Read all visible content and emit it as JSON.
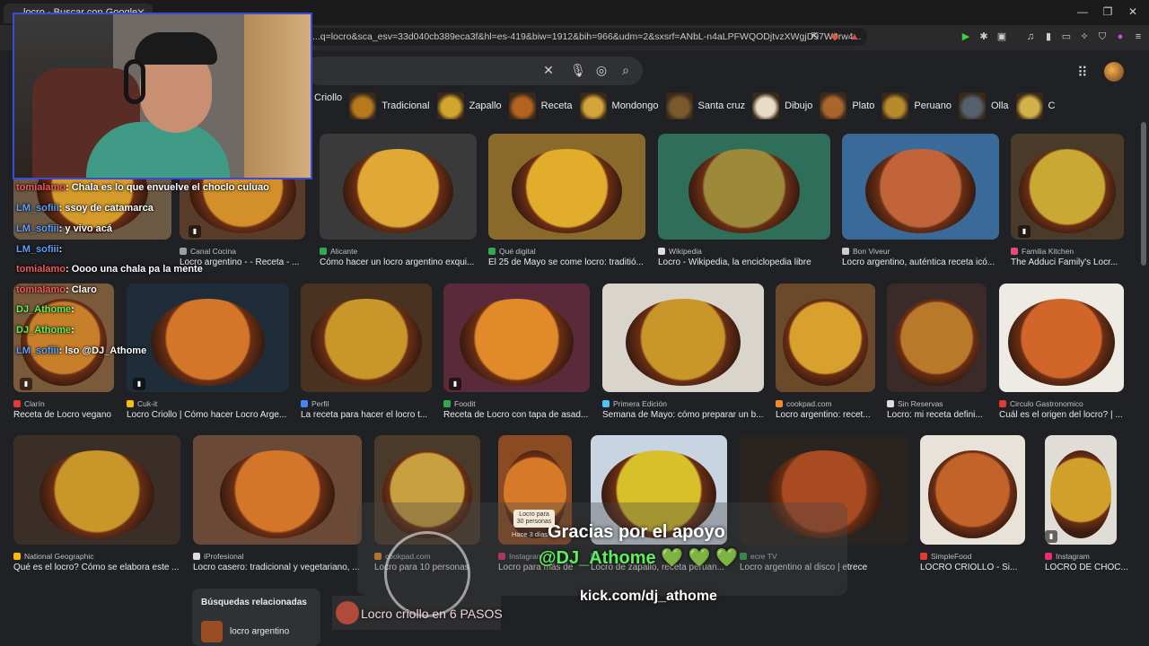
{
  "browser": {
    "tab_title": "locro - Buscar con Google",
    "url": "...q=locro&sca_esv=33d040cb389eca3f&hl=es-419&biw=1912&bih=966&udm=2&sxsrf=ANbL-n4aLPFWQODjtvzXWgjD97W9rw4...",
    "controls": {
      "minimize": "—",
      "restore": "❐",
      "close": "✕"
    }
  },
  "search": {
    "clear_icon": "✕"
  },
  "chips": [
    {
      "label": "Criollo",
      "color": "#c98a2a",
      "has_thumb": false
    },
    {
      "label": "Tradicional",
      "color": "#b9781e",
      "has_thumb": true
    },
    {
      "label": "Zapallo",
      "color": "#d1a62a",
      "has_thumb": true
    },
    {
      "label": "Receta",
      "color": "#b3621f",
      "has_thumb": true
    },
    {
      "label": "Mondongo",
      "color": "#d3a43a",
      "has_thumb": true
    },
    {
      "label": "Santa cruz",
      "color": "#7a5a2c",
      "has_thumb": true
    },
    {
      "label": "Dibujo",
      "color": "#e7dcc6",
      "has_thumb": true
    },
    {
      "label": "Plato",
      "color": "#a8672a",
      "has_thumb": true
    },
    {
      "label": "Peruano",
      "color": "#b88a2c",
      "has_thumb": true
    },
    {
      "label": "Olla",
      "color": "#55606f",
      "has_thumb": true
    },
    {
      "label": "C",
      "color": "#d4b24a",
      "has_thumb": true
    }
  ],
  "results": {
    "row1": [
      {
        "source": "",
        "title": "",
        "fav": "#888888",
        "bg": "#6c5a44",
        "food": "#d49a2a"
      },
      {
        "source": "Canal Cocina",
        "title": "Locro argentino - - Receta - ...",
        "fav": "#9aa0a6",
        "bg": "#5a3c2a",
        "food": "#d3902a"
      },
      {
        "source": "Alicante",
        "title": "Cómo hacer un locro argentino exqui...",
        "fav": "#34a853",
        "bg": "#3a3a3a",
        "food": "#e0a834"
      },
      {
        "source": "Qué digital",
        "title": "El 25 de Mayo se come locro: traditió...",
        "fav": "#34a853",
        "bg": "#8a6a2a",
        "food": "#e3ad2c"
      },
      {
        "source": "Wikipedia",
        "title": "Locro - Wikipedia, la enciclopedia libre",
        "fav": "#dddddd",
        "bg": "#2f6f5a",
        "food": "#9c8a3a"
      },
      {
        "source": "Bon Viveur",
        "title": "Locro argentino, auténtica receta icó...",
        "fav": "#cccccc",
        "bg": "#3a6a9a",
        "food": "#c2643a"
      },
      {
        "source": "Familia Kitchen",
        "title": "The Adduci Family's Locr...",
        "fav": "#e84a7a",
        "bg": "#4a3a2a",
        "food": "#c9a833"
      }
    ],
    "row2": [
      {
        "source": "Clarín",
        "title": "Receta de Locro vegano",
        "fav": "#e53935",
        "bg": "#7a5a3a",
        "food": "#c77f2a"
      },
      {
        "source": "Cuk-it",
        "title": "Locro Criollo | Cómo hacer Locro Arge...",
        "fav": "#fbbc04",
        "bg": "#1f2d3a",
        "food": "#d4762a"
      },
      {
        "source": "Perfil",
        "title": "La receta para hacer el locro t...",
        "fav": "#4285f4",
        "bg": "#4a3220",
        "food": "#c8972a"
      },
      {
        "source": "Foodit",
        "title": "Receta de Locro con tapa de asad...",
        "fav": "#34a853",
        "bg": "#5a2a3a",
        "food": "#e08a2a"
      },
      {
        "source": "Primera Edición",
        "title": "Semana de Mayo: cómo preparar un b...",
        "fav": "#4fc3f7",
        "bg": "#d9d4cc",
        "food": "#c9962a"
      },
      {
        "source": "cookpad.com",
        "title": "Locro argentino: recet...",
        "fav": "#f08a2a",
        "bg": "#6a4a2a",
        "food": "#d8a02c"
      },
      {
        "source": "Sin Reservas",
        "title": "Locro: mi receta defini...",
        "fav": "#dddddd",
        "bg": "#3a2a2a",
        "food": "#b87a2a"
      },
      {
        "source": "Circulo Gastronomico",
        "title": "Cuál es el origen del locro? | ...",
        "fav": "#e53935",
        "bg": "#eeeae4",
        "food": "#d2662a"
      }
    ],
    "row3": [
      {
        "source": "National Geographic",
        "title": "Qué es el locro? Cómo se elabora este ...",
        "fav": "#fbbc04",
        "bg": "#3a2e26",
        "food": "#c9962a"
      },
      {
        "source": "iProfesional",
        "title": "Locro casero: tradicional y vegetariano, ...",
        "fav": "#dddddd",
        "bg": "#6a4a36",
        "food": "#d4762a"
      },
      {
        "source": "cookpad.com",
        "title": "Locro para 10 personas",
        "fav": "#f08a2a",
        "bg": "#4a3a2a",
        "food": "#c8a040"
      },
      {
        "source": "Instagram",
        "title": "Locro para más de",
        "fav": "#e1306c",
        "bg": "#8a4a22",
        "food": "#d67a2a"
      },
      {
        "source": "",
        "title": "Locro de zapallo, receta peruan...",
        "fav": "#4285f4",
        "bg": "#c9d4e2",
        "food": "#d8c02a"
      },
      {
        "source": "ecre TV",
        "title": "Locro argentino al disco | etrece",
        "fav": "#34a853",
        "bg": "#2a2420",
        "food": "#a84a22"
      },
      {
        "source": "SimpleFood",
        "title": "LOCRO CRIOLLO - Si...",
        "fav": "#e53935",
        "bg": "#e8e2d8",
        "food": "#c2642a"
      },
      {
        "source": "Instagram",
        "title": "LOCRO DE CHOC...",
        "fav": "#e1306c",
        "bg": "#e0dcd6",
        "food": "#d0a02a"
      }
    ],
    "cookpad_badge": "Locro para 30 personas",
    "cookpad_time": "Hace 3 días"
  },
  "related": {
    "title": "Búsquedas relacionadas",
    "item": "locro argentino"
  },
  "video_banner": "Locro criollo en 6 PASOS",
  "chat": [
    {
      "user": "tomialamo",
      "user_color": "red",
      "msg": ": Chala es lo que envuelve el choclo culuao"
    },
    {
      "user": "LM_sofiii",
      "user_color": "blue",
      "msg": ": ssoy de catamarca"
    },
    {
      "user": "LM_sofiii",
      "user_color": "blue",
      "msg": ": y vivo acá"
    },
    {
      "user": "LM_sofiii",
      "user_color": "blue",
      "msg": ":"
    },
    {
      "user": "tomialamo",
      "user_color": "red",
      "msg": ": Oooo una chala pa la mente"
    },
    {
      "user": "tomialamo",
      "user_color": "red",
      "msg": ": Claro"
    },
    {
      "user": "DJ_Athome",
      "user_color": "green",
      "msg": ":"
    },
    {
      "user": "DJ_Athome",
      "user_color": "green",
      "msg": ":"
    },
    {
      "user": "LM_sofiii",
      "user_color": "blue",
      "msg": ": lso @DJ_Athome"
    }
  ],
  "stream_overlay": {
    "thanks": "Gracias por el apoyo",
    "handle": "@DJ_Athome",
    "hearts": "💚 💚 💚",
    "link": "kick.com/dj_athome"
  }
}
